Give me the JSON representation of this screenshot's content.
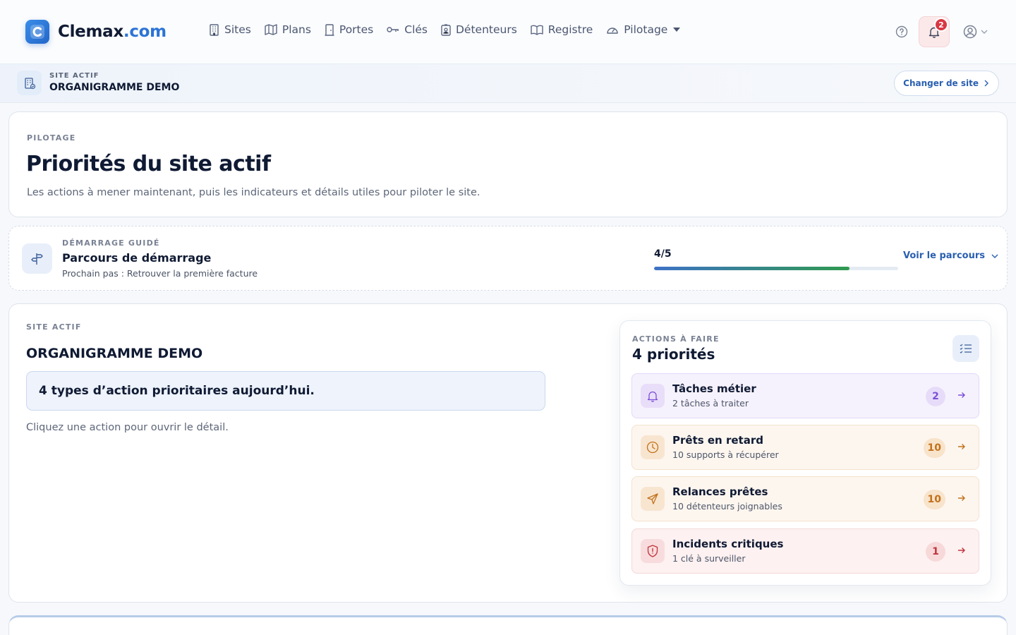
{
  "brand": {
    "name_main": "Clemax",
    "name_accent": ".com",
    "color": "#2c74d6"
  },
  "nav": {
    "items": [
      {
        "label": "Sites",
        "icon": "building-icon"
      },
      {
        "label": "Plans",
        "icon": "map-icon"
      },
      {
        "label": "Portes",
        "icon": "door-icon"
      },
      {
        "label": "Clés",
        "icon": "key-icon"
      },
      {
        "label": "Détenteurs",
        "icon": "badge-icon"
      },
      {
        "label": "Registre",
        "icon": "book-icon"
      },
      {
        "label": "Pilotage",
        "icon": "gauge-icon"
      }
    ]
  },
  "header": {
    "notifications_count": "2",
    "help_icon": "help-icon",
    "user_icon": "user-icon"
  },
  "site_bar": {
    "label": "SITE ACTIF",
    "name": "ORGANIGRAMME DEMO",
    "change_label": "Changer de site"
  },
  "hero": {
    "eyebrow": "PILOTAGE",
    "title": "Priorités du site actif",
    "subtitle": "Les actions à mener maintenant, puis les indicateurs et détails utiles pour piloter le site."
  },
  "onboarding": {
    "eyebrow": "DÉMARRAGE GUIDÉ",
    "title": "Parcours de démarrage",
    "next_step": "Prochain pas : Retrouver la première facture",
    "progress_label": "4/5",
    "progress_fraction": 0.8,
    "link_label": "Voir le parcours"
  },
  "main": {
    "eyebrow": "SITE ACTIF",
    "site_name": "ORGANIGRAMME DEMO",
    "callout": "4 types d’action prioritaires aujourd’hui.",
    "hint": "Cliquez une action pour ouvrir le détail."
  },
  "actions": {
    "eyebrow": "ACTIONS À FAIRE",
    "title": "4 priorités",
    "items": [
      {
        "name": "Tâches métier",
        "desc": "2 tâches à traiter",
        "count": "2",
        "icon": "bell-icon",
        "accent": "#7b4fd6",
        "bg": "#f6f2fd",
        "border": "#e3d8f7",
        "icon_bg": "#e9def9",
        "count_bg": "#e6dcf9"
      },
      {
        "name": "Prêts en retard",
        "desc": "10 supports à récupérer",
        "count": "10",
        "icon": "clock-icon",
        "accent": "#c2721c",
        "bg": "#fdf6ef",
        "border": "#f3e2cf",
        "icon_bg": "#f8e5d0",
        "count_bg": "#f8e3cb"
      },
      {
        "name": "Relances prêtes",
        "desc": "10 détenteurs joignables",
        "count": "10",
        "icon": "send-icon",
        "accent": "#c2721c",
        "bg": "#fdf6ef",
        "border": "#f3e2cf",
        "icon_bg": "#f8e5d0",
        "count_bg": "#f8e3cb"
      },
      {
        "name": "Incidents critiques",
        "desc": "1 clé à surveiller",
        "count": "1",
        "icon": "shield-alert-icon",
        "accent": "#c0343e",
        "bg": "#fdf1f1",
        "border": "#f4d9da",
        "icon_bg": "#f8dcdd",
        "count_bg": "#f7d9da"
      }
    ]
  }
}
